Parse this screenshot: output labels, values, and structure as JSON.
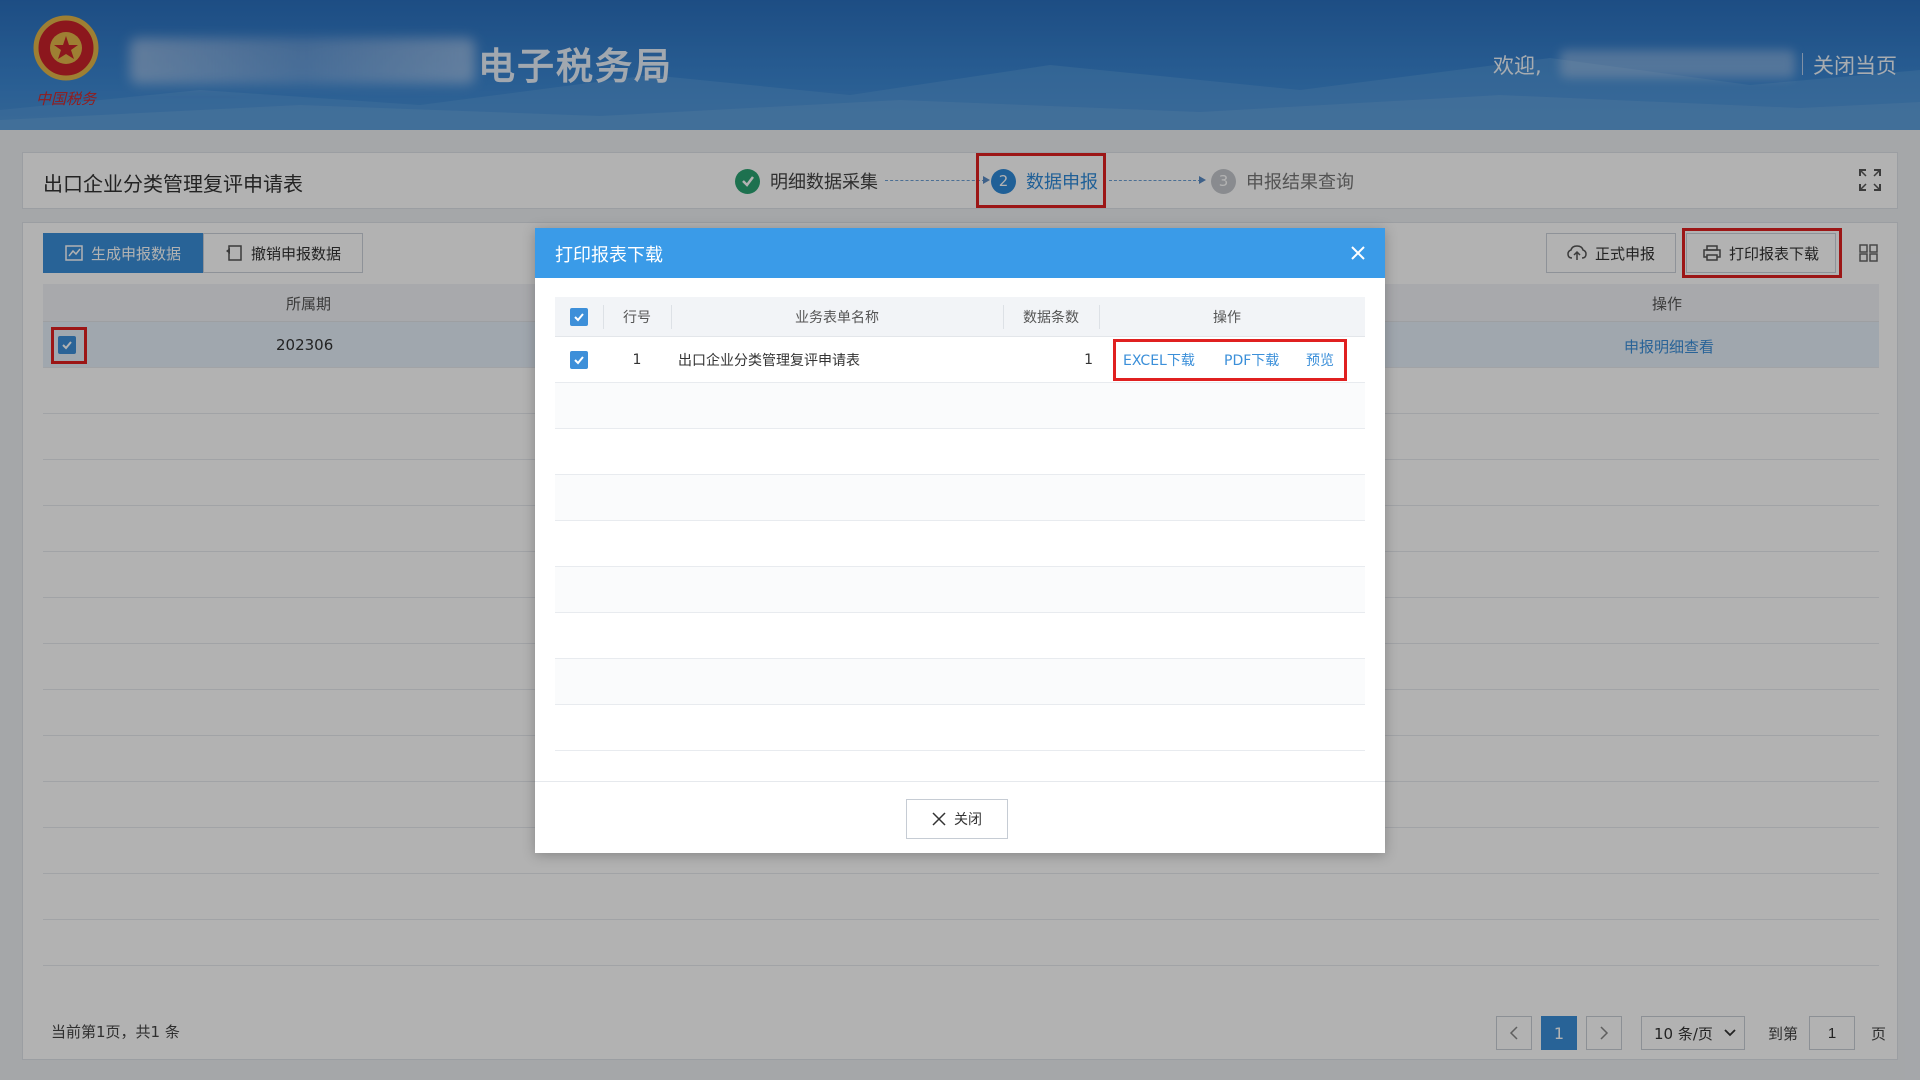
{
  "header": {
    "site_title": "电子税务局",
    "welcome": "欢迎,",
    "close_page": "关闭当页",
    "emblem_text": "中国税务"
  },
  "titlebar": {
    "page_title": "出口企业分类管理复评申请表",
    "steps": [
      {
        "num": "✓",
        "label": "明细数据采集",
        "status": "done"
      },
      {
        "num": "2",
        "label": "数据申报",
        "status": "active"
      },
      {
        "num": "3",
        "label": "申报结果查询",
        "status": "pending"
      }
    ]
  },
  "toolbar": {
    "generate": "生成申报数据",
    "revoke": "撤销申报数据",
    "formal_submit": "正式申报",
    "print_download": "打印报表下载"
  },
  "grid": {
    "columns": {
      "period": "所属期",
      "action": "操作"
    },
    "rows": [
      {
        "period": "202306",
        "action": "申报明细查看"
      }
    ]
  },
  "pager": {
    "summary": "当前第1页，共1 条",
    "current_page": "1",
    "page_size": "10 条/页",
    "goto_label": "到第",
    "goto_value": "1",
    "page_unit": "页"
  },
  "modal": {
    "title": "打印报表下载",
    "columns": {
      "row_no": "行号",
      "name": "业务表单名称",
      "count": "数据条数",
      "ops": "操作"
    },
    "rows": [
      {
        "row_no": "1",
        "name": "出口企业分类管理复评申请表",
        "count": "1",
        "excel": "EXCEL下载",
        "pdf": "PDF下载",
        "preview": "预览"
      }
    ],
    "close": "关闭"
  },
  "colors": {
    "header_blue": "#2a6fbd",
    "modal_header": "#3a9be8",
    "primary": "#3a8fd9",
    "link": "#3b8fd9",
    "highlight_red": "#e02020",
    "step_done": "#2aa271"
  }
}
